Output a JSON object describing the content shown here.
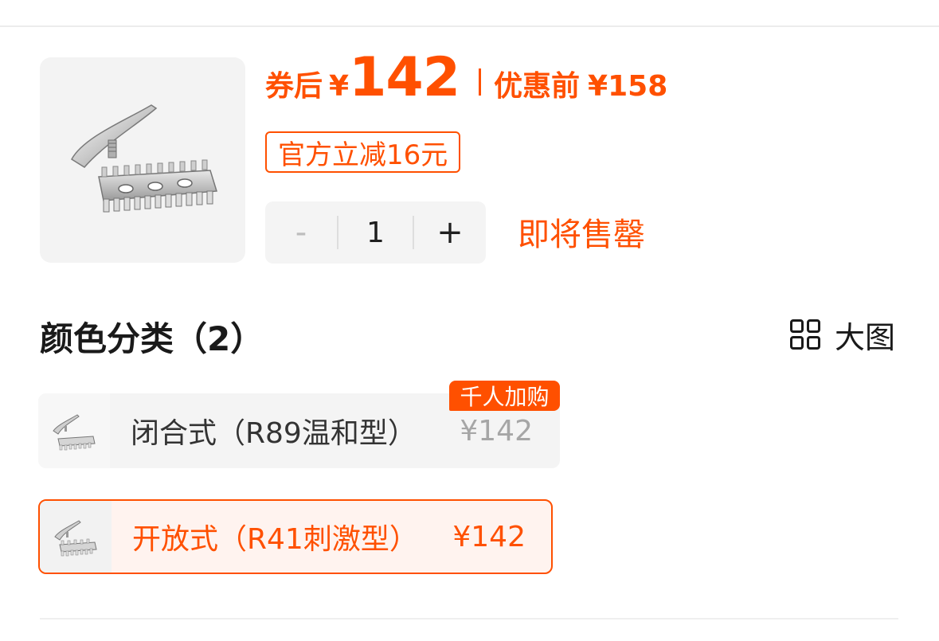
{
  "product": {
    "image_alt": "razor-head-product-image"
  },
  "price": {
    "after_coupon_label": "券后",
    "currency": "¥",
    "after_coupon_value": "142",
    "before_discount_label": "优惠前",
    "before_discount_value": "¥158"
  },
  "coupon": {
    "label": "官方立减16元"
  },
  "quantity": {
    "minus": "-",
    "value": "1",
    "plus": "+"
  },
  "stock_status": "即将售罄",
  "sku_section": {
    "title": "颜色分类（2）",
    "big_view_label": "大图",
    "options": [
      {
        "name": "闭合式（R89温和型）",
        "price": "¥142",
        "badge": "千人加购",
        "selected": false
      },
      {
        "name": "开放式（R41刺激型）",
        "price": "¥142",
        "badge": "",
        "selected": true
      }
    ]
  },
  "colors": {
    "accent": "#ff5000",
    "selected_bg": "#fff3ef",
    "muted_price": "#a6a6a6"
  }
}
